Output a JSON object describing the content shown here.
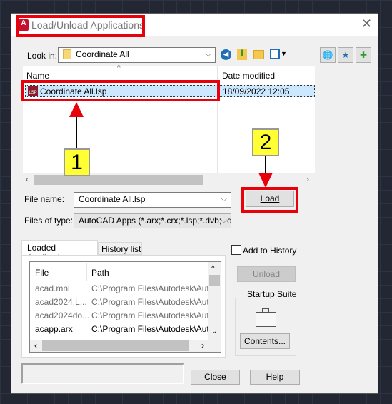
{
  "dialog": {
    "title": "Load/Unload Applications",
    "close_icon": "close-icon"
  },
  "look_in": {
    "label": "Look in:",
    "value": "Coordinate All"
  },
  "file_list": {
    "columns": [
      "Name",
      "Date modified"
    ],
    "rows": [
      {
        "name": "Coordinate All.lsp",
        "date": "18/09/2022 12:05",
        "selected": true
      }
    ]
  },
  "file_name": {
    "label": "File name:",
    "value": "Coordinate All.lsp"
  },
  "file_type": {
    "label": "Files of type:",
    "value": "AutoCAD Apps (*.arx;*.crx;*.lsp;*.dvb;*.dbx;*."
  },
  "load_button": "Load",
  "annotations": {
    "step1": "1",
    "step2": "2",
    "highlight_color": "#e8000b",
    "label_color": "#ffff33"
  },
  "tabs": [
    {
      "label": "Loaded Applications",
      "active": true
    },
    {
      "label": "History list",
      "active": false
    }
  ],
  "loaded": {
    "columns": [
      "File",
      "Path"
    ],
    "rows": [
      {
        "file": "acad.mnl",
        "path": "C:\\Program Files\\Autodesk\\AutoCA.",
        "dim": true
      },
      {
        "file": "acad2024.L...",
        "path": "C:\\Program Files\\Autodesk\\AutoCA.",
        "dim": true
      },
      {
        "file": "acad2024do...",
        "path": "C:\\Program Files\\Autodesk\\AutoCA.",
        "dim": true
      },
      {
        "file": "acapp.arx",
        "path": "C:\\Program Files\\Autodesk\\AutoCA.",
        "dim": false
      }
    ]
  },
  "add_to_history": {
    "label": "Add to History",
    "checked": false
  },
  "unload_button": "Unload",
  "startup_suite": {
    "label": "Startup Suite",
    "contents_button": "Contents..."
  },
  "close_button": "Close",
  "help_button": "Help"
}
